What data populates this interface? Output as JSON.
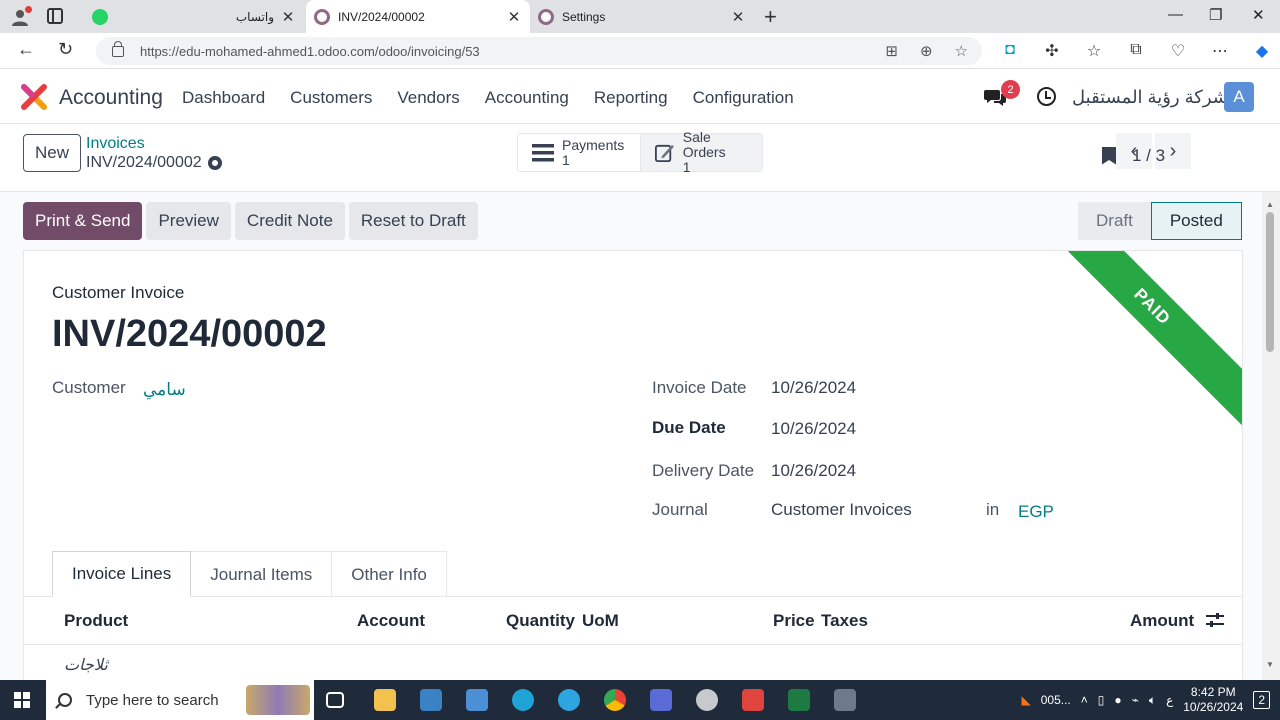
{
  "browser": {
    "tabs": [
      {
        "title": "واتساب",
        "close": "✕"
      },
      {
        "title": "INV/2024/00002",
        "close": "✕"
      },
      {
        "title": "Settings",
        "close": "✕"
      }
    ],
    "url": "https://edu-mohamed-ahmed1.odoo.com/odoo/invoicing/53"
  },
  "odoo": {
    "app_name": "Accounting",
    "menu": [
      "Dashboard",
      "Customers",
      "Vendors",
      "Accounting",
      "Reporting",
      "Configuration"
    ],
    "chat_badge": "2",
    "company": "شركة رؤية المستقبل",
    "avatar_letter": "A"
  },
  "control_panel": {
    "new_label": "New",
    "breadcrumb_parent": "Invoices",
    "breadcrumb_current": "INV/2024/00002",
    "smart_buttons": [
      {
        "label": "Payments",
        "count": "1",
        "icon": "list-icon"
      },
      {
        "label": "Sale Orders",
        "count": "1",
        "icon": "sale-order-icon"
      }
    ],
    "pager": "1 / 3"
  },
  "actions": [
    "Print & Send",
    "Preview",
    "Credit Note",
    "Reset to Draft"
  ],
  "status": {
    "stages": [
      "Draft",
      "Posted"
    ],
    "current": "Posted"
  },
  "invoice": {
    "ribbon": "PAID",
    "type": "Customer Invoice",
    "number": "INV/2024/00002",
    "customer_label": "Customer",
    "customer": "سامي",
    "invoice_date_label": "Invoice Date",
    "invoice_date": "10/26/2024",
    "due_date_label": "Due Date",
    "due_date": "10/26/2024",
    "delivery_date_label": "Delivery Date",
    "delivery_date": "10/26/2024",
    "journal_label": "Journal",
    "journal": "Customer Invoices",
    "in_label": "in",
    "currency": "EGP"
  },
  "tabs": [
    "Invoice Lines",
    "Journal Items",
    "Other Info"
  ],
  "table": {
    "columns": [
      "Product",
      "Account",
      "Quantity",
      "UoM",
      "Price",
      "Taxes",
      "Amount"
    ],
    "first_row_product": "ثلاجات"
  },
  "taskbar": {
    "search_placeholder": "Type here to search",
    "tray_label": "005...",
    "lang": "ع",
    "time": "8:42 PM",
    "date": "10/26/2024",
    "notif_count": "2"
  }
}
